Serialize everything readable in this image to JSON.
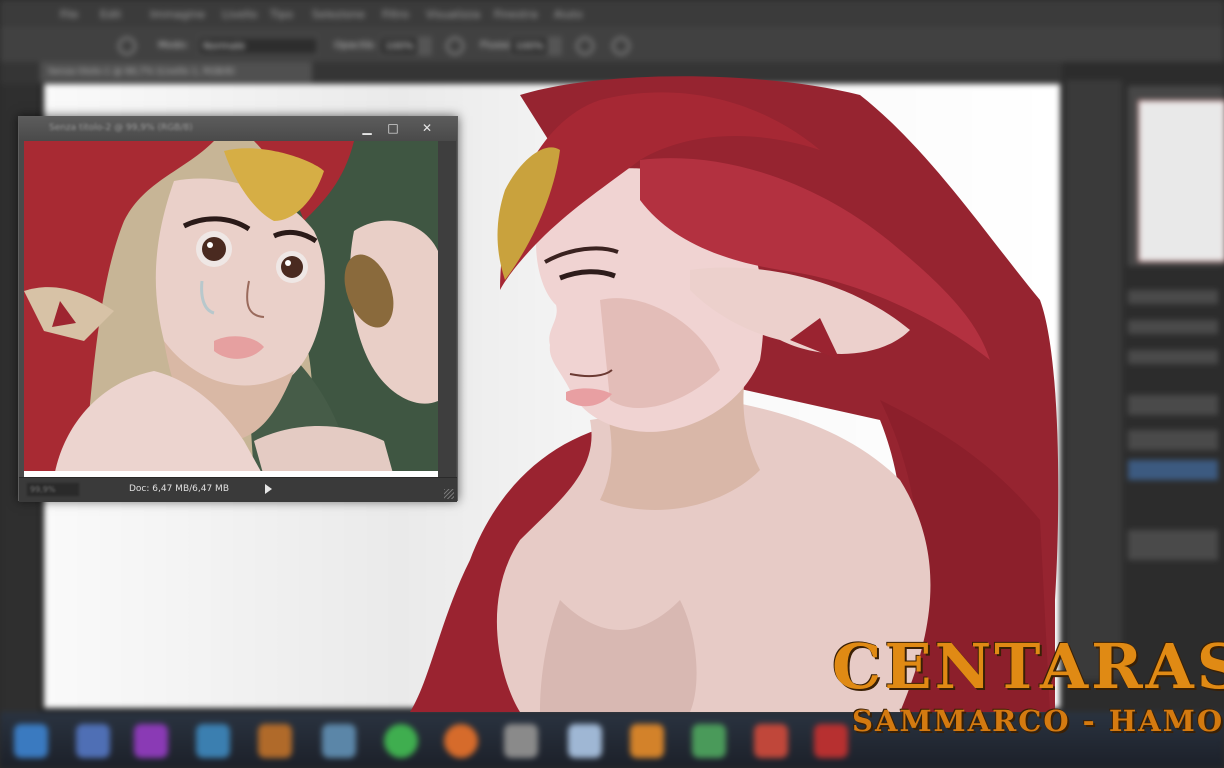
{
  "menubar": {
    "items": [
      "File",
      "Edit",
      "Immagine",
      "Livello",
      "Tipo",
      "Selezione",
      "Filtro",
      "Visualizza",
      "Finestra",
      "Aiuto"
    ]
  },
  "options_bar": {
    "mode_label": "Modo:",
    "mode_value": "Normale",
    "opacity_label": "Opacità:",
    "opacity_value": "100%",
    "flow_label": "Flusso:",
    "flow_value": "100%"
  },
  "document_tab": {
    "label": "Senza titolo-1 @ 66,7% (Livello 1, RGB/8)"
  },
  "floating_window": {
    "title": "Senza titolo-2 @ 99,9% (RGB/8)",
    "minimize_glyph": "▁",
    "maximize_glyph": "□",
    "close_glyph": "✕",
    "zoom_value": "99,9%",
    "doc_info": "Doc: 6,47 MB/6,47 MB"
  },
  "overlay": {
    "title": "CENTARAS",
    "subtitle": "SAMMARCO - HAMON"
  },
  "colors": {
    "hair_red": "#9e2530",
    "skin": "#eccdcc",
    "accent_orange": "#e08a14",
    "ui_dark": "#2b2b2b"
  },
  "taskbar": {
    "icons": [
      "blue-app-icon",
      "purple-app-icon",
      "folder-icon",
      "media-icon",
      "chrome-icon",
      "firefox-icon",
      "mail-icon",
      "settings-icon",
      "vlc-icon",
      "game-icon",
      "photo-icon",
      "red-app-icon",
      "blue-app-2-icon"
    ]
  }
}
